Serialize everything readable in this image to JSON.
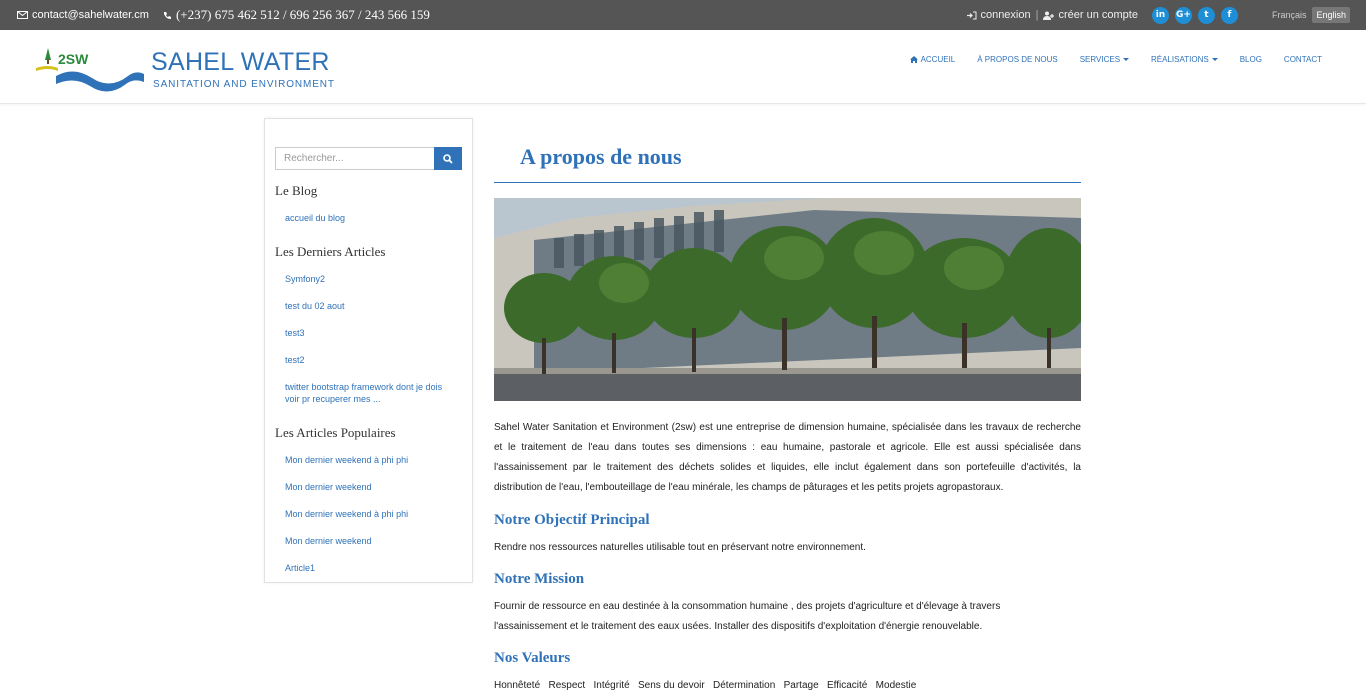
{
  "topbar": {
    "email": "contact@sahelwater.cm",
    "phone": "(+237) 675 462 512 / 696 256 367 / 243 566 159",
    "login": "connexion",
    "signup": "créer un compte",
    "social": [
      "in",
      "G+",
      "t",
      "f"
    ],
    "lang_fr": "Français",
    "lang_en": "English"
  },
  "header": {
    "brand": "SAHEL WATER",
    "tagline": "SANITATION AND ENVIRONMENT",
    "logo_text": "2SW",
    "nav": {
      "home": "ACCUEIL",
      "about": "À PROPOS DE NOUS",
      "services": "SERVICES",
      "realisations": "RÉALISATIONS",
      "blog": "BLOG",
      "contact": "CONTACT"
    }
  },
  "sidebar": {
    "search_placeholder": "Rechercher...",
    "blog_heading": "Le Blog",
    "blog_home": "accueil du blog",
    "latest_heading": "Les Derniers Articles",
    "latest": [
      "Symfony2",
      "test du 02 aout",
      "test3",
      "test2",
      "twitter bootstrap framework dont je dois voir pr recuperer mes ..."
    ],
    "popular_heading": "Les Articles Populaires",
    "popular": [
      "Mon dernier weekend à phi phi",
      "Mon dernier weekend",
      "Mon dernier weekend à phi phi",
      "Mon dernier weekend",
      "Article1"
    ]
  },
  "main": {
    "title": "A propos de nous",
    "intro": "Sahel Water Sanitation et Environment (2sw) est une entreprise de dimension humaine, spécialisée dans les travaux de recherche et le traitement de l'eau dans toutes ses dimensions : eau humaine, pastorale et agricole. Elle est aussi spécialisée dans l'assainissement par le traitement des déchets solides et liquides, elle inclut également dans son portefeuille d'activités, la distribution de l'eau, l'embouteillage de l'eau minérale, les champs de pâturages et les petits projets agropastoraux.",
    "objective_heading": "Notre Objectif Principal",
    "objective_text": "Rendre nos ressources naturelles utilisable tout en préservant notre environnement.",
    "mission_heading": "Notre Mission",
    "mission_text": "Fournir de ressource en eau destinée à la consommation humaine , des projets d'agriculture et d'élevage à travers l'assainissement et le traitement des eaux usées. Installer des dispositifs d'exploitation d'énergie renouvelable.",
    "values_heading": "Nos Valeurs",
    "values_text": "Honnêteté   Respect   Intégrité   Sens du devoir   Détermination   Partage   Efficacité   Modestie"
  },
  "colors": {
    "accent": "#2f72b8",
    "topbar": "#555555",
    "social": "#1e8fd6"
  }
}
